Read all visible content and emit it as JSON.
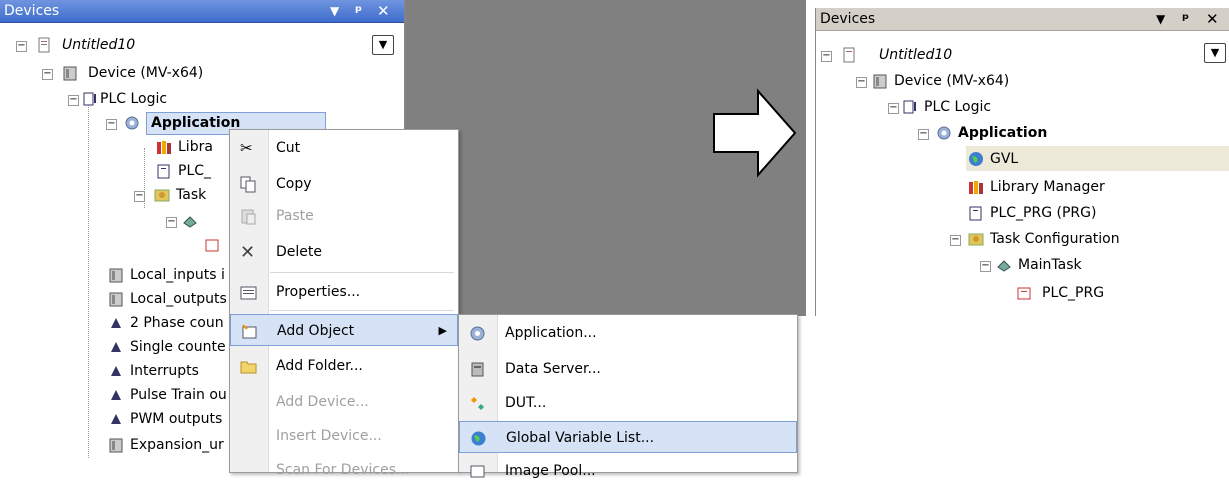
{
  "left_panel": {
    "title": "Devices",
    "tree": {
      "root": "Untitled10",
      "device": "Device (MV-x64)",
      "plc_logic": "PLC Logic",
      "application": "Application",
      "library": "Libra",
      "plc_prg": "PLC_",
      "task": "Task",
      "local_inputs": "Local_inputs i",
      "local_outputs": "Local_outputs",
      "two_phase": "2 Phase coun",
      "single_counter": "Single counte",
      "interrupts": "Interrupts",
      "pulse_train": "Pulse Train ou",
      "pwm": "PWM outputs",
      "expansion": "Expansion_ur"
    }
  },
  "context_menu": {
    "items": [
      {
        "label": "Cut",
        "icon": "scissors-icon",
        "enabled": true
      },
      {
        "label": "Copy",
        "icon": "copy-icon",
        "enabled": true
      },
      {
        "label": "Paste",
        "icon": "paste-icon",
        "enabled": false
      },
      {
        "label": "Delete",
        "icon": "delete-icon",
        "enabled": true
      },
      {
        "label": "Properties...",
        "icon": "properties-icon",
        "enabled": true
      },
      {
        "label": "Add Object",
        "icon": "add-object-icon",
        "enabled": true,
        "submenu": true,
        "selected": true
      },
      {
        "label": "Add Folder...",
        "icon": "folder-icon",
        "enabled": true
      },
      {
        "label": "Add Device...",
        "icon": "",
        "enabled": false
      },
      {
        "label": "Insert Device...",
        "icon": "",
        "enabled": false
      },
      {
        "label": "Scan For Devices...",
        "icon": "",
        "enabled": false
      }
    ]
  },
  "submenu": {
    "items": [
      {
        "label": "Application...",
        "icon": "gear-icon"
      },
      {
        "label": "Data Server...",
        "icon": "data-server-icon"
      },
      {
        "label": "DUT...",
        "icon": "dut-icon"
      },
      {
        "label": "Global Variable List...",
        "icon": "globe-icon",
        "selected": true
      },
      {
        "label": "Image Pool...",
        "icon": "image-pool-icon"
      }
    ]
  },
  "right_panel": {
    "title": "Devices",
    "tree": {
      "root": "Untitled10",
      "device": "Device (MV-x64)",
      "plc_logic": "PLC Logic",
      "application": "Application",
      "gvl": "GVL",
      "library": "Library Manager",
      "plc_prg": "PLC_PRG (PRG)",
      "task": "Task Configuration",
      "maintask": "MainTask",
      "plc_prg_call": "PLC_PRG"
    }
  },
  "colors": {
    "titlebar_blue": "#4a78d4",
    "selection": "#d6e3f7",
    "highlight_row": "#ece9d8",
    "gray_area": "#808080"
  }
}
